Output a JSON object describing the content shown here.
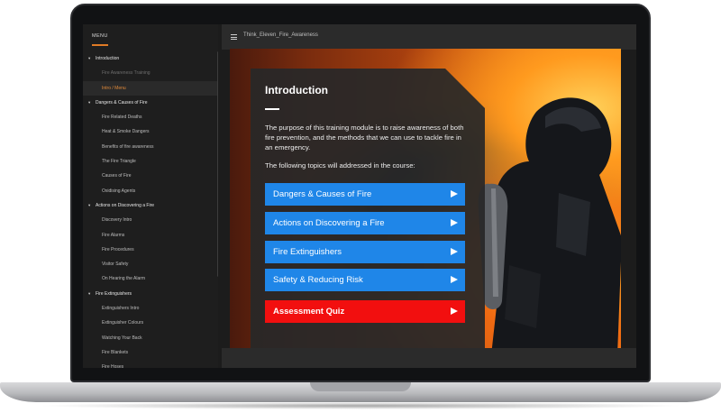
{
  "sidebar": {
    "menu_title": "MENU",
    "items": [
      {
        "label": "Introduction",
        "type": "section",
        "expanded": true
      },
      {
        "label": "Fire Awareness Training",
        "type": "item",
        "state": "visited"
      },
      {
        "label": "Intro / Menu",
        "type": "item",
        "state": "active"
      },
      {
        "label": "Dangers & Causes of Fire",
        "type": "section",
        "expanded": true
      },
      {
        "label": "Fire Related Deaths",
        "type": "item"
      },
      {
        "label": "Heat & Smoke Dangers",
        "type": "item"
      },
      {
        "label": "Benefits of fire awareness",
        "type": "item"
      },
      {
        "label": "The Fire Triangle",
        "type": "item"
      },
      {
        "label": "Causes of Fire",
        "type": "item"
      },
      {
        "label": "Oxidising Agents",
        "type": "item"
      },
      {
        "label": "Actions on Discovering a Fire",
        "type": "section",
        "expanded": true
      },
      {
        "label": "Discovery Intro",
        "type": "item"
      },
      {
        "label": "Fire Alarms",
        "type": "item"
      },
      {
        "label": "Fire Procedures",
        "type": "item"
      },
      {
        "label": "Visitor Safety",
        "type": "item"
      },
      {
        "label": "On Hearing the Alarm",
        "type": "item"
      },
      {
        "label": "Fire Extinguishers",
        "type": "section",
        "expanded": true
      },
      {
        "label": "Extinguishers Intro",
        "type": "item"
      },
      {
        "label": "Extinguisher Colours",
        "type": "item"
      },
      {
        "label": "Watching Your Back",
        "type": "item"
      },
      {
        "label": "Fire Blankets",
        "type": "item"
      },
      {
        "label": "Fire Hoses",
        "type": "item"
      }
    ]
  },
  "header": {
    "menu_icon": "hamburger-icon",
    "course_title": "Think_Eleven_Fire_Awareness"
  },
  "intro": {
    "title": "Introduction",
    "paragraph": "The purpose of this training module is to raise awareness of both fire prevention, and the methods that we can use to tackle fire in an emergency.",
    "topics_lead": "The following topics will addressed in the course:",
    "topics": [
      {
        "label": "Dangers & Causes of Fire",
        "color": "#1f86e8"
      },
      {
        "label": "Actions on Discovering a Fire",
        "color": "#1f86e8"
      },
      {
        "label": "Fire Extinguishers",
        "color": "#1f86e8"
      },
      {
        "label": "Safety & Reducing Risk",
        "color": "#1f86e8"
      },
      {
        "label": "Assessment Quiz",
        "color": "#f20f0f"
      }
    ]
  },
  "colors": {
    "accent_orange": "#e07a25",
    "topic_blue": "#1f86e8",
    "quiz_red": "#f20f0f"
  }
}
